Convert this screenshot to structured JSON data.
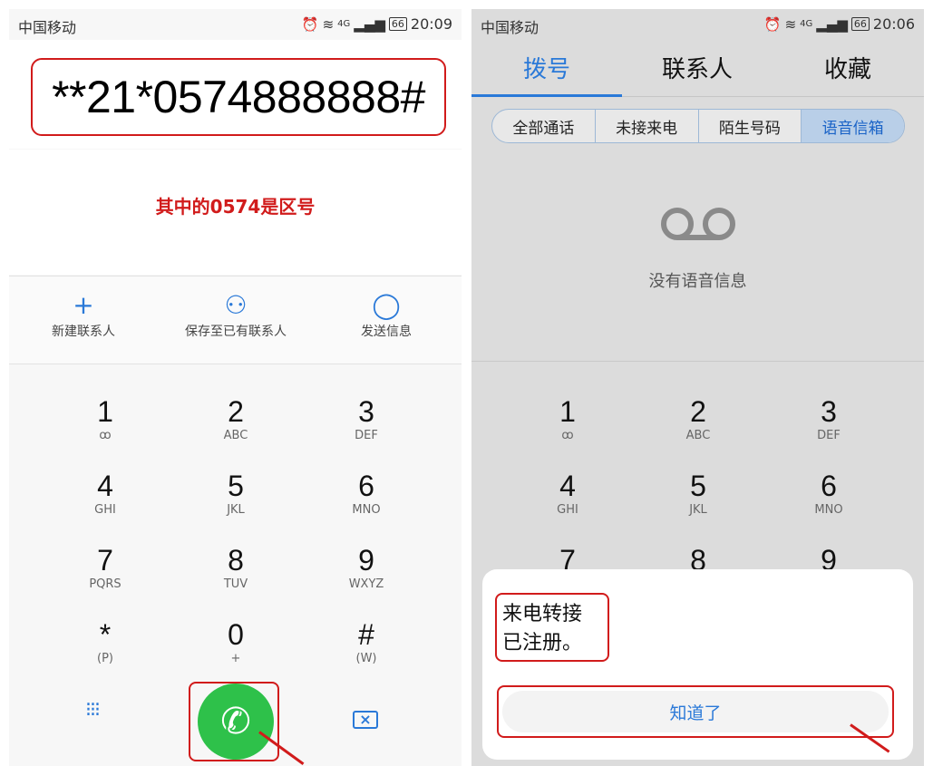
{
  "left": {
    "status": {
      "carrier": "中国移动",
      "net": "4G",
      "battery": "66",
      "time": "20:09"
    },
    "number": "**21*0574888888#",
    "hint": "其中的0574是区号",
    "actions": [
      {
        "label": "新建联系人"
      },
      {
        "label": "保存至已有联系人"
      },
      {
        "label": "发送信息"
      }
    ]
  },
  "keys": [
    {
      "num": "1",
      "sub": "ꝏ"
    },
    {
      "num": "2",
      "sub": "ABC"
    },
    {
      "num": "3",
      "sub": "DEF"
    },
    {
      "num": "4",
      "sub": "GHI"
    },
    {
      "num": "5",
      "sub": "JKL"
    },
    {
      "num": "6",
      "sub": "MNO"
    },
    {
      "num": "7",
      "sub": "PQRS"
    },
    {
      "num": "8",
      "sub": "TUV"
    },
    {
      "num": "9",
      "sub": "WXYZ"
    },
    {
      "num": "*",
      "sub": "(P)"
    },
    {
      "num": "0",
      "sub": "+"
    },
    {
      "num": "#",
      "sub": "(W)"
    }
  ],
  "right": {
    "status": {
      "carrier": "中国移动",
      "net": "4G",
      "battery": "66",
      "time": "20:06"
    },
    "tabs": [
      "拨号",
      "联系人",
      "收藏"
    ],
    "filters": [
      "全部通话",
      "未接来电",
      "陌生号码",
      "语音信箱"
    ],
    "voicemail_empty": "没有语音信息",
    "dialog": {
      "message_line1": "来电转接",
      "message_line2": "已注册。",
      "ok": "知道了"
    }
  },
  "colors": {
    "accent": "#2a79d8",
    "annotation": "#d11b1b",
    "call": "#2ec14a"
  }
}
